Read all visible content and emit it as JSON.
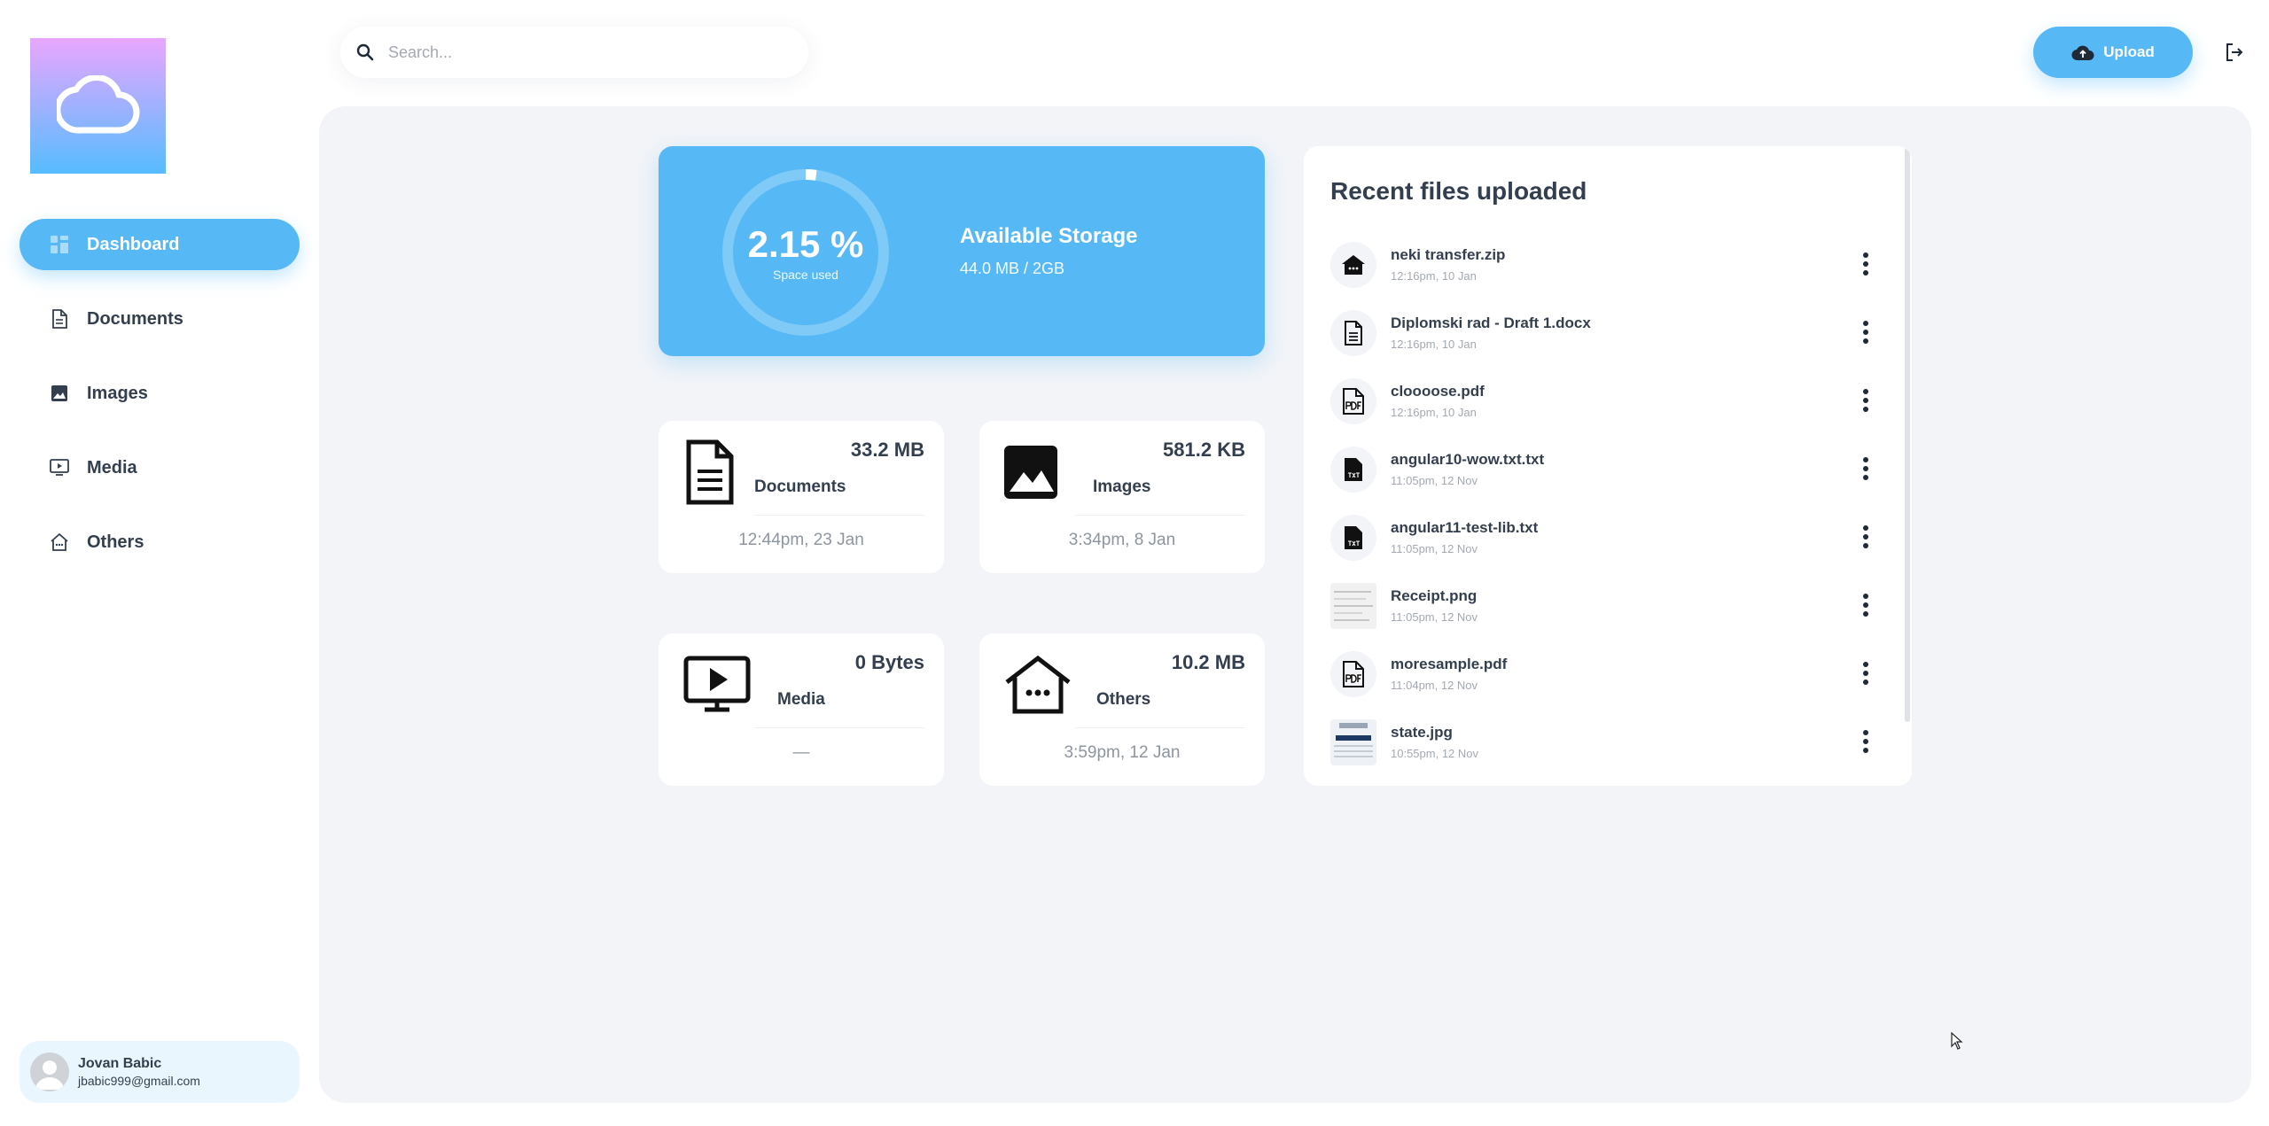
{
  "sidebar": {
    "items": [
      {
        "label": "Dashboard",
        "icon": "dashboard-icon",
        "active": true
      },
      {
        "label": "Documents",
        "icon": "document-icon"
      },
      {
        "label": "Images",
        "icon": "image-icon"
      },
      {
        "label": "Media",
        "icon": "media-icon"
      },
      {
        "label": "Others",
        "icon": "others-icon"
      }
    ],
    "user": {
      "name": "Jovan Babic",
      "email": "jbabic999@gmail.com"
    }
  },
  "header": {
    "search_placeholder": "Search...",
    "upload_label": "Upload"
  },
  "storage": {
    "percent_label": "2.15 %",
    "percent_value": 2.15,
    "space_used_label": "Space used",
    "title": "Available Storage",
    "value": "44.0 MB / 2GB"
  },
  "categories": [
    {
      "name": "Documents",
      "size": "33.2 MB",
      "date": "12:44pm, 23 Jan",
      "icon": "document-icon"
    },
    {
      "name": "Images",
      "size": "581.2 KB",
      "date": "3:34pm, 8 Jan",
      "icon": "image-icon"
    },
    {
      "name": "Media",
      "size": "0 Bytes",
      "date": "—",
      "icon": "media-icon"
    },
    {
      "name": "Others",
      "size": "10.2 MB",
      "date": "3:59pm, 12 Jan",
      "icon": "others-icon"
    }
  ],
  "recent": {
    "title": "Recent files uploaded",
    "files": [
      {
        "name": "neki transfer.zip",
        "date": "12:16pm, 10 Jan",
        "icon": "zip-icon"
      },
      {
        "name": "Diplomski rad - Draft 1.docx",
        "date": "12:16pm, 10 Jan",
        "icon": "docx-icon"
      },
      {
        "name": "cloooose.pdf",
        "date": "12:16pm, 10 Jan",
        "icon": "pdf-icon"
      },
      {
        "name": "angular10-wow.txt.txt",
        "date": "11:05pm, 12 Nov",
        "icon": "txt-icon"
      },
      {
        "name": "angular11-test-lib.txt",
        "date": "11:05pm, 12 Nov",
        "icon": "txt-icon"
      },
      {
        "name": "Receipt.png",
        "date": "11:05pm, 12 Nov",
        "icon": "image-thumbnail"
      },
      {
        "name": "moresample.pdf",
        "date": "11:04pm, 12 Nov",
        "icon": "pdf-icon"
      },
      {
        "name": "state.jpg",
        "date": "10:55pm, 12 Nov",
        "icon": "image-thumbnail"
      }
    ]
  },
  "colors": {
    "accent": "#56b8f5",
    "background": "#f2f4f8",
    "text": "#333f4e",
    "muted": "#a3a9b3"
  }
}
